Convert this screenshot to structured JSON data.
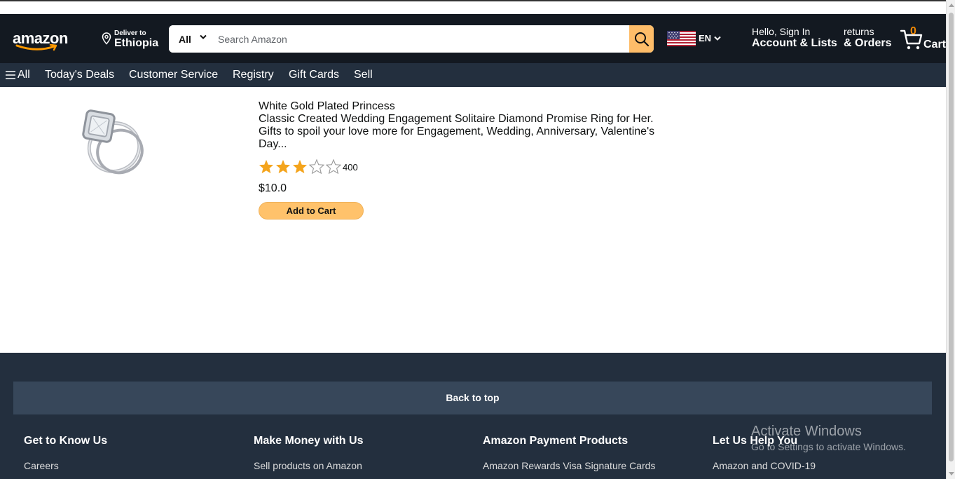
{
  "header": {
    "logo_text": "amazon",
    "deliver_line1": "Deliver to",
    "deliver_line2": "Ethiopia",
    "search_category": "All",
    "search_placeholder": "Search Amazon",
    "language_code": "EN",
    "account_line1": "Hello, Sign In",
    "account_line2": "Account & Lists",
    "orders_line1": "returns",
    "orders_line2": "& Orders",
    "cart_count": "0",
    "cart_label": "Cart"
  },
  "nav": {
    "all_label": "All",
    "items": [
      "Today's Deals",
      "Customer Service",
      "Registry",
      "Gift Cards",
      "Sell"
    ]
  },
  "product": {
    "title": "White Gold Plated Princess",
    "description": "Classic Created Wedding Engagement Solitaire Diamond Promise Ring for Her. Gifts to spoil your love more for Engagement, Wedding, Anniversary, Valentine's Day...",
    "rating": 3,
    "rating_max": 5,
    "rating_count": "400",
    "price": "$10.0",
    "add_to_cart_label": "Add to Cart"
  },
  "footer": {
    "back_to_top": "Back to top",
    "columns": [
      {
        "heading": "Get to Know Us",
        "first_link": "Careers"
      },
      {
        "heading": "Make Money with Us",
        "first_link": "Sell products on Amazon"
      },
      {
        "heading": "Amazon Payment Products",
        "first_link": "Amazon Rewards Visa Signature Cards"
      },
      {
        "heading": "Let Us Help You",
        "first_link": "Amazon and COVID-19"
      }
    ]
  },
  "watermark": {
    "line1": "Activate Windows",
    "line2": "Go to Settings to activate Windows."
  },
  "colors": {
    "header_bg": "#131921",
    "nav_bg": "#232f3e",
    "search_button": "#febd69",
    "star": "#f4a41c",
    "add_button": "#ffc26b",
    "back_to_top_bg": "#37475a"
  },
  "icons": {
    "location": "location-pin-icon",
    "search": "magnifier-icon",
    "cart": "shopping-cart-icon",
    "menu": "hamburger-menu-icon",
    "flag": "us-flag-icon"
  }
}
